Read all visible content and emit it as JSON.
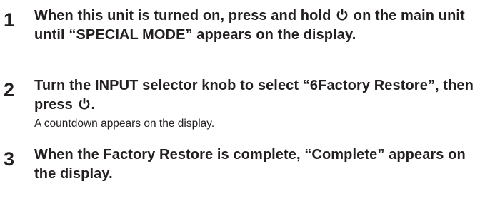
{
  "steps": [
    {
      "number": "1",
      "before_icon": "When this unit is turned on, press and hold",
      "icon": "power-icon",
      "after_icon": "on the main unit until “SPECIAL MODE” appears on the display.",
      "note": ""
    },
    {
      "number": "2",
      "before_icon": "Turn the INPUT selector knob to select “6Factory Restore”, then press",
      "icon": "power-icon",
      "after_icon": ".",
      "note": "A countdown appears on the display."
    },
    {
      "number": "3",
      "text": "When the Factory Restore is complete, “Complete” appears on the display.",
      "note": ""
    }
  ]
}
